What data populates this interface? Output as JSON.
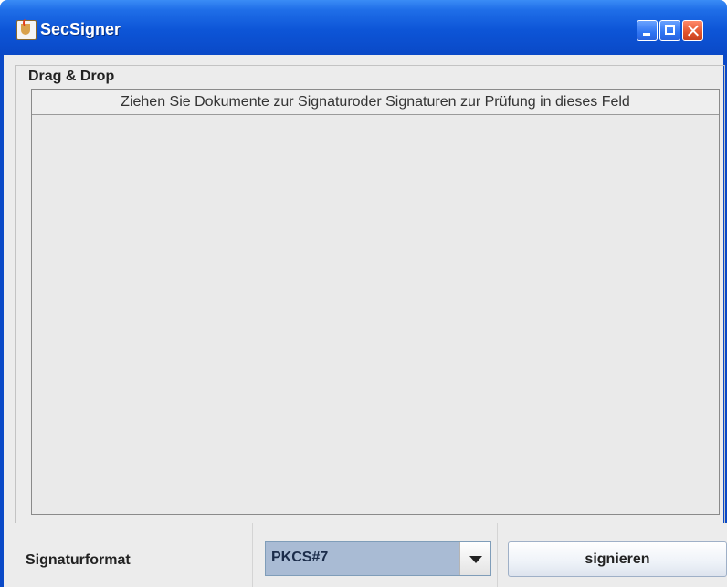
{
  "window": {
    "title": "SecSigner",
    "icon": "java-cup-icon"
  },
  "titlebar_buttons": {
    "minimize": "minimize-icon",
    "maximize": "maximize-icon",
    "close": "close-icon"
  },
  "group": {
    "label": "Drag & Drop"
  },
  "drop_area": {
    "header": "Ziehen Sie Dokumente zur Signaturoder Signaturen zur Prüfung in dieses Feld"
  },
  "bottom": {
    "format_label": "Signaturformat",
    "format_value": "PKCS#7",
    "sign_button": "signieren"
  },
  "colors": {
    "titlebar": "#0a49c7",
    "close": "#e0532c",
    "combo_selected": "#a9bbd4"
  }
}
